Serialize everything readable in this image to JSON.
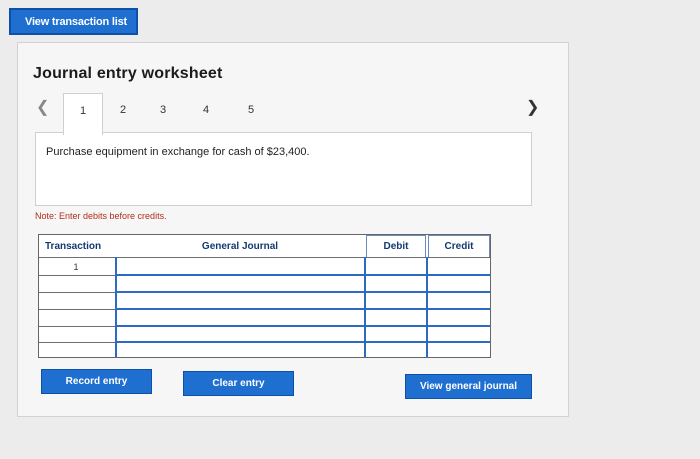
{
  "top_button": "View transaction list",
  "title": "Journal entry worksheet",
  "tabs": [
    "1",
    "2",
    "3",
    "4",
    "5"
  ],
  "active_tab": "1",
  "description": "Purchase equipment in exchange for cash of $23,400.",
  "note": "Note: Enter debits before credits.",
  "table": {
    "headers": {
      "transaction": "Transaction",
      "journal": "General Journal",
      "debit": "Debit",
      "credit": "Credit"
    },
    "row_number": "1"
  },
  "buttons": {
    "record": "Record entry",
    "clear": "Clear entry",
    "view_general": "View general journal"
  },
  "colors": {
    "accent": "#1f6fd1",
    "note": "#b03018",
    "header_text": "#123a70"
  }
}
